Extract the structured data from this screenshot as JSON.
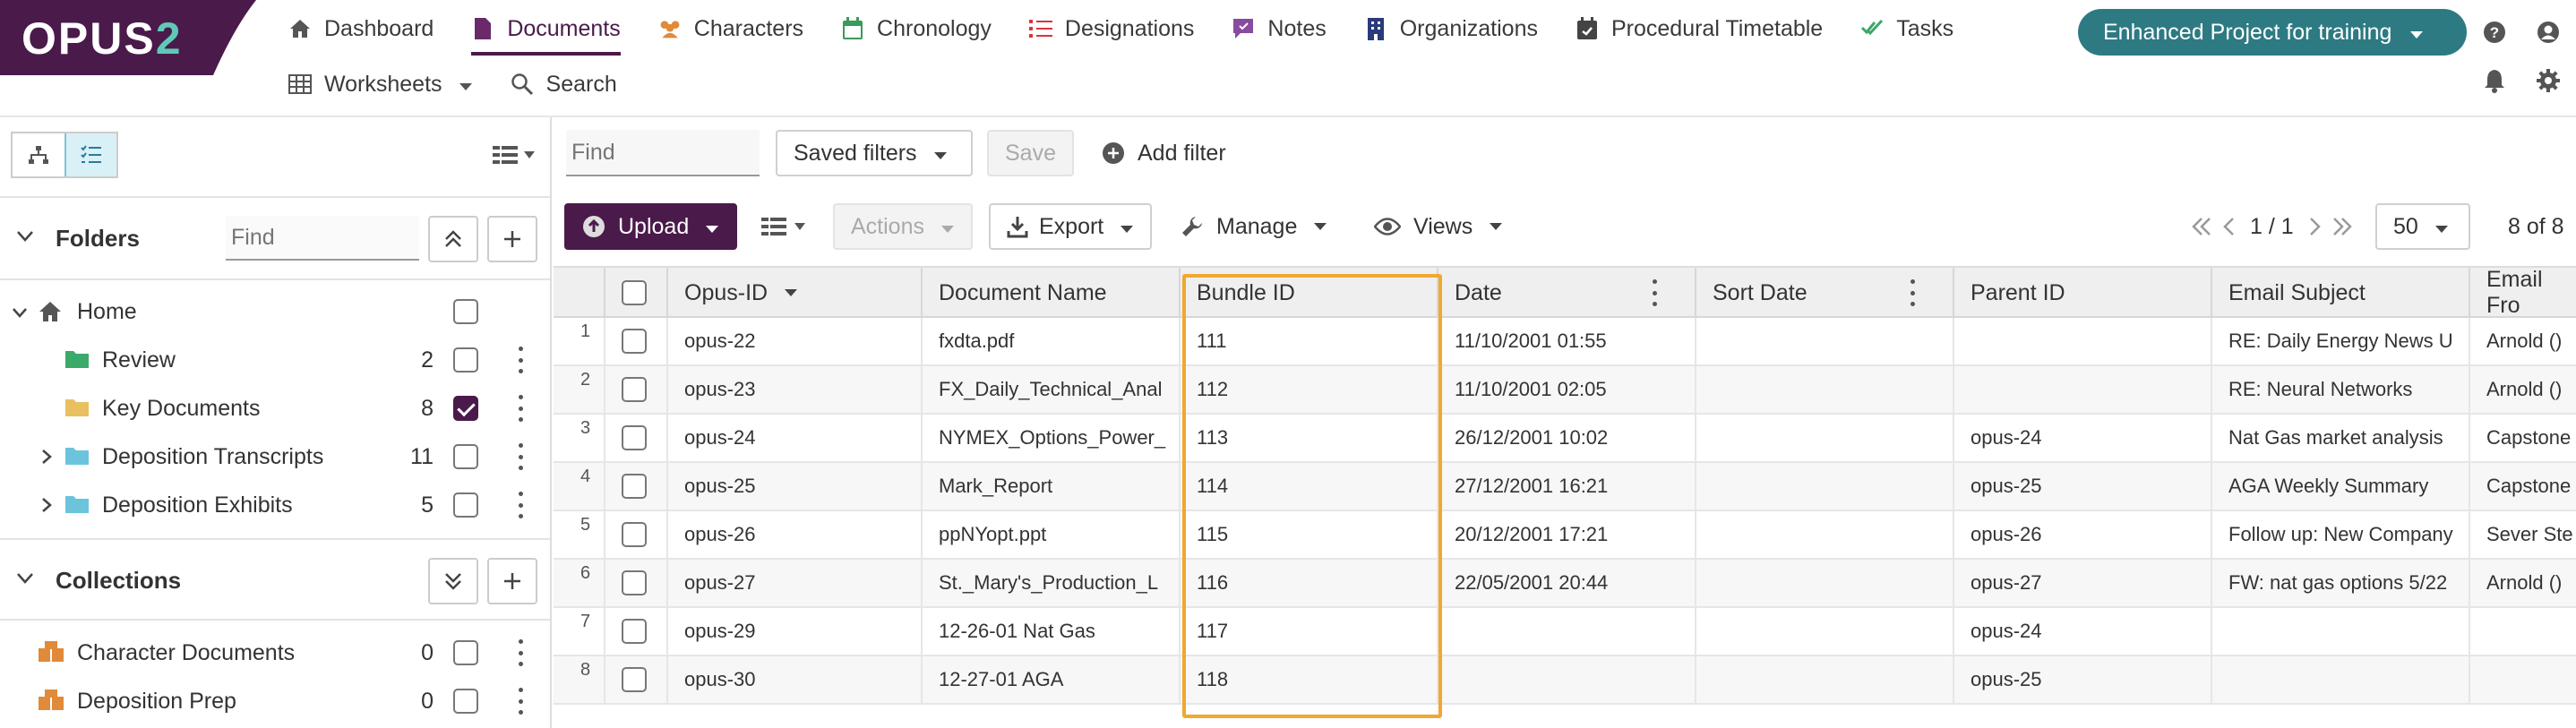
{
  "logo": {
    "text_main": "OPUS",
    "text_accent": "2"
  },
  "nav": {
    "row1": [
      {
        "label": "Dashboard",
        "icon": "home-icon",
        "active": false
      },
      {
        "label": "Documents",
        "icon": "document-icon",
        "active": true
      },
      {
        "label": "Characters",
        "icon": "people-icon",
        "active": false
      },
      {
        "label": "Chronology",
        "icon": "calendar-icon",
        "active": false
      },
      {
        "label": "Designations",
        "icon": "list-icon",
        "active": false
      },
      {
        "label": "Notes",
        "icon": "note-icon",
        "active": false
      },
      {
        "label": "Organizations",
        "icon": "building-icon",
        "active": false
      },
      {
        "label": "Procedural Timetable",
        "icon": "calendar-check-icon",
        "active": false
      },
      {
        "label": "Tasks",
        "icon": "check-double-icon",
        "active": false
      }
    ],
    "row2": [
      {
        "label": "Worksheets",
        "icon": "table-icon"
      },
      {
        "label": "Search",
        "icon": "search-icon"
      }
    ],
    "project": "Enhanced Project for training"
  },
  "sidebar": {
    "folders_title": "Folders",
    "folders_find_placeholder": "Find",
    "folders": [
      {
        "label": "Home",
        "count": "",
        "checked": false,
        "expandable": true,
        "expanded": true
      },
      {
        "label": "Review",
        "count": "2",
        "checked": false
      },
      {
        "label": "Key Documents",
        "count": "8",
        "checked": true
      },
      {
        "label": "Deposition Transcripts",
        "count": "11",
        "checked": false,
        "expandable": true
      },
      {
        "label": "Deposition Exhibits",
        "count": "5",
        "checked": false,
        "expandable": true
      }
    ],
    "collections_title": "Collections",
    "collections": [
      {
        "label": "Character Documents",
        "count": "0",
        "checked": false
      },
      {
        "label": "Deposition Prep",
        "count": "0",
        "checked": false
      }
    ]
  },
  "toolbar": {
    "find_placeholder": "Find",
    "saved_filters": "Saved filters",
    "save": "Save",
    "add_filter": "Add filter",
    "upload": "Upload",
    "actions": "Actions",
    "export": "Export",
    "manage": "Manage",
    "views": "Views",
    "page_indicator": "1 / 1",
    "page_size": "50",
    "record_count": "8 of 8"
  },
  "table": {
    "columns": [
      "Opus-ID",
      "Document Name",
      "Bundle ID",
      "Date",
      "Sort Date",
      "Parent ID",
      "Email Subject",
      "Email Fro"
    ],
    "rows": [
      {
        "n": "1",
        "opus": "opus-22",
        "name": "fxdta.pdf",
        "bundle": "111",
        "date": "11/10/2001 01:55",
        "sort": "",
        "parent": "",
        "subject": "RE: Daily Energy News U",
        "from": "Arnold ()"
      },
      {
        "n": "2",
        "opus": "opus-23",
        "name": "FX_Daily_Technical_Anal",
        "bundle": "112",
        "date": "11/10/2001 02:05",
        "sort": "",
        "parent": "",
        "subject": "RE: Neural Networks",
        "from": "Arnold ()"
      },
      {
        "n": "3",
        "opus": "opus-24",
        "name": "NYMEX_Options_Power_",
        "bundle": "113",
        "date": "26/12/2001 10:02",
        "sort": "",
        "parent": "opus-24",
        "subject": "Nat Gas market analysis",
        "from": "Capstone"
      },
      {
        "n": "4",
        "opus": "opus-25",
        "name": "Mark_Report",
        "bundle": "114",
        "date": "27/12/2001 16:21",
        "sort": "",
        "parent": "opus-25",
        "subject": "AGA Weekly Summary",
        "from": "Capstone"
      },
      {
        "n": "5",
        "opus": "opus-26",
        "name": "ppNYopt.ppt",
        "bundle": "115",
        "date": "20/12/2001 17:21",
        "sort": "",
        "parent": "opus-26",
        "subject": "Follow up: New Company",
        "from": "Sever Ste"
      },
      {
        "n": "6",
        "opus": "opus-27",
        "name": "St._Mary's_Production_L",
        "bundle": "116",
        "date": "22/05/2001 20:44",
        "sort": "",
        "parent": "opus-27",
        "subject": "FW: nat gas options 5/22",
        "from": "Arnold ()"
      },
      {
        "n": "7",
        "opus": "opus-29",
        "name": "12-26-01 Nat Gas",
        "bundle": "117",
        "date": "",
        "sort": "",
        "parent": "opus-24",
        "subject": "",
        "from": ""
      },
      {
        "n": "8",
        "opus": "opus-30",
        "name": "12-27-01 AGA",
        "bundle": "118",
        "date": "",
        "sort": "",
        "parent": "opus-25",
        "subject": "",
        "from": ""
      }
    ]
  },
  "colors": {
    "brand": "#4a1a4a",
    "project": "#2d7a83",
    "highlight": "#f0a830",
    "accent": "#5fc9b7"
  }
}
